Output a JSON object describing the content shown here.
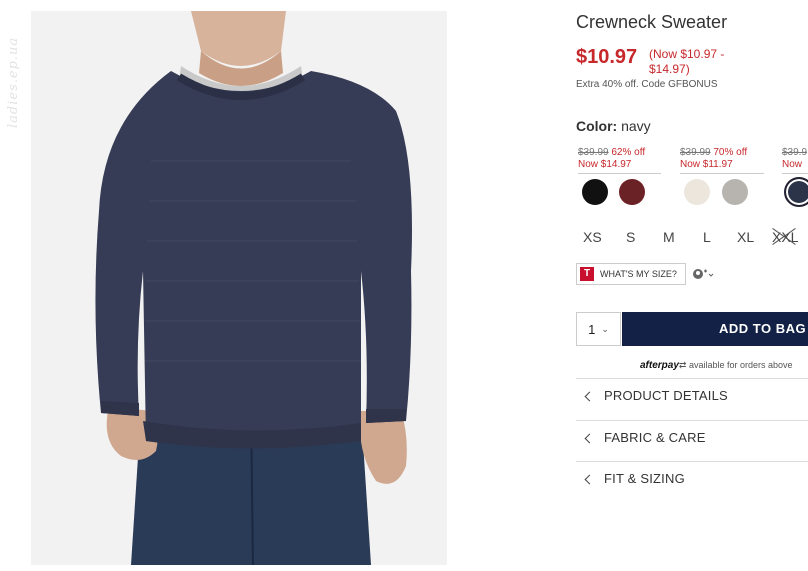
{
  "watermark": "ladies.ep.ua",
  "product": {
    "title": "Crewneck Sweater",
    "price": "$10.97",
    "price_range_line1": "(Now $10.97 -",
    "price_range_line2": "$14.97)",
    "promo": "Extra 40% off. Code GFBONUS"
  },
  "color": {
    "label": "Color:",
    "value": "navy",
    "groups": [
      {
        "was": "$39.99",
        "off": "62% off",
        "now": "Now $14.97"
      },
      {
        "was": "$39.99",
        "off": "70% off",
        "now": "Now $11.97"
      },
      {
        "was": "$39.9",
        "off": "",
        "now": "Now"
      }
    ],
    "swatches": [
      {
        "name": "black",
        "hex": "#111111"
      },
      {
        "name": "burgundy",
        "hex": "#6b2226"
      },
      {
        "name": "cream",
        "hex": "#ece6dc"
      },
      {
        "name": "grey",
        "hex": "#b7b4af"
      },
      {
        "name": "navy",
        "hex": "#2b3448"
      }
    ]
  },
  "sizes": [
    "XS",
    "S",
    "M",
    "L",
    "XL",
    "XXL"
  ],
  "fit": {
    "logo": "T",
    "label": "WHAT'S MY SIZE?",
    "account_icon": "person-plus-icon"
  },
  "bag": {
    "quantity": "1",
    "button": "ADD TO BAG"
  },
  "afterpay": {
    "brand": "afterpay",
    "text": "available for orders above"
  },
  "accordion": [
    "PRODUCT DETAILS",
    "FABRIC & CARE",
    "FIT & SIZING"
  ],
  "colors": {
    "sale_red": "#c6282b",
    "navy_button": "#122145"
  }
}
